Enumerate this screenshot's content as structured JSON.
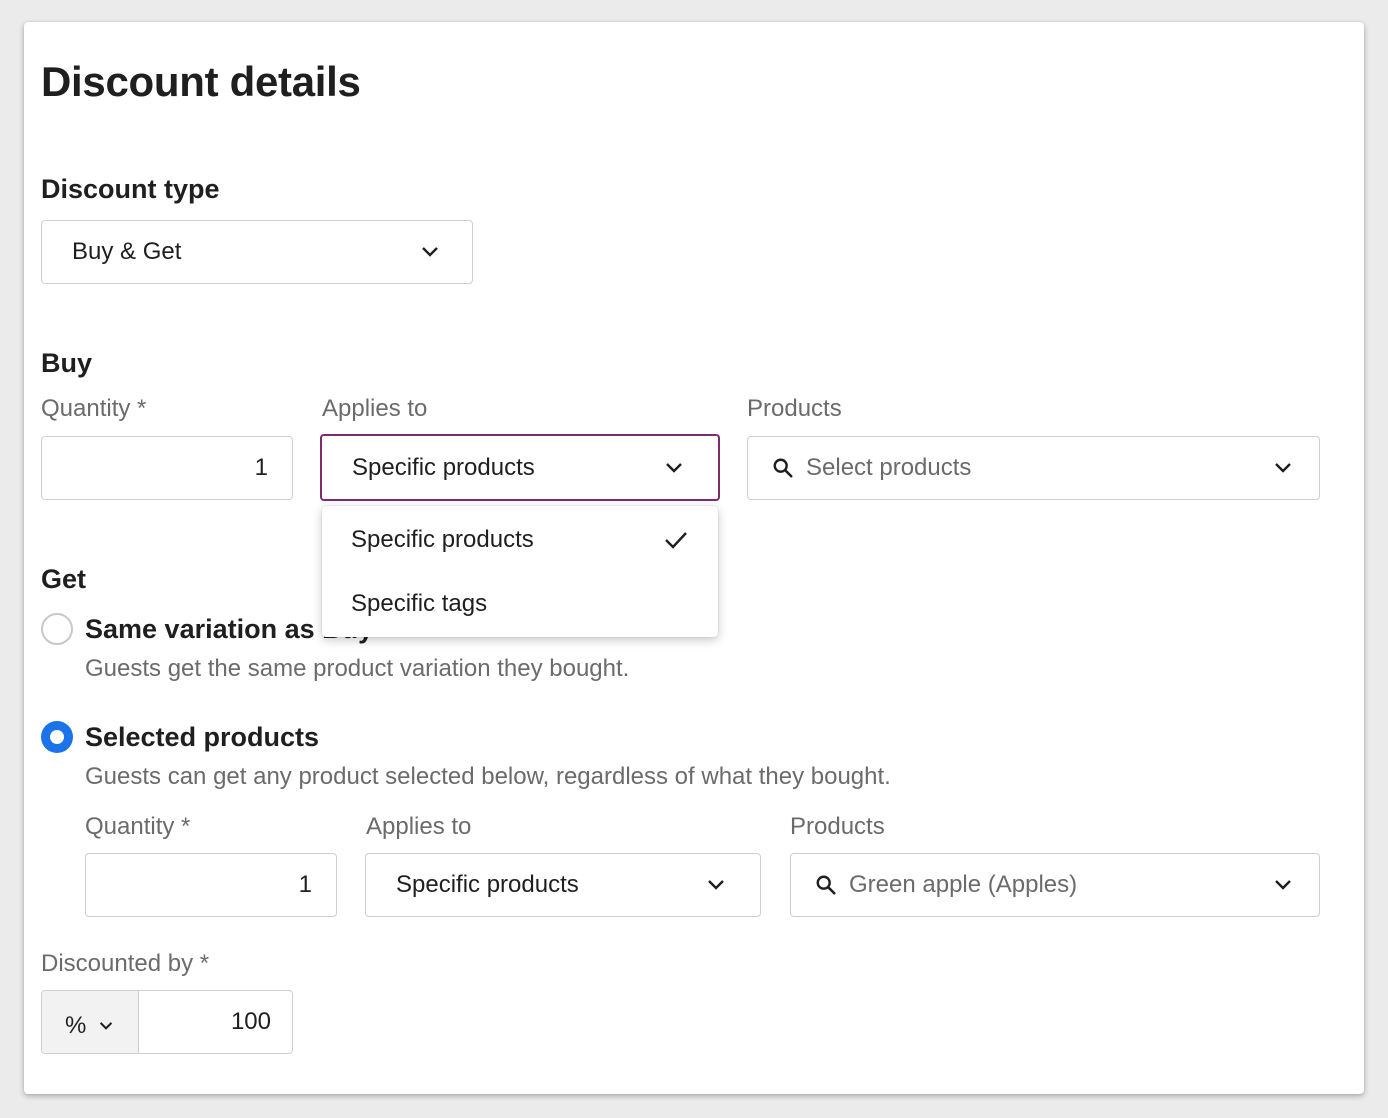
{
  "title": "Discount details",
  "discount_type": {
    "label": "Discount type",
    "value": "Buy & Get"
  },
  "buy": {
    "heading": "Buy",
    "quantity_label": "Quantity *",
    "quantity_value": "1",
    "applies_to_label": "Applies to",
    "applies_to_value": "Specific products",
    "products_label": "Products",
    "products_placeholder": "Select products",
    "applies_to_menu": [
      {
        "label": "Specific products",
        "selected": true
      },
      {
        "label": "Specific tags",
        "selected": false
      }
    ]
  },
  "get": {
    "heading": "Get",
    "options": [
      {
        "title": "Same variation as Buy",
        "description": "Guests get the same product variation they bought.",
        "selected": false
      },
      {
        "title": "Selected products",
        "description": "Guests can get any product selected below, regardless of what they bought.",
        "selected": true
      }
    ],
    "quantity_label": "Quantity *",
    "quantity_value": "1",
    "applies_to_label": "Applies to",
    "applies_to_value": "Specific products",
    "products_label": "Products",
    "products_value": "Green apple (Apples)"
  },
  "discounted_by": {
    "label": "Discounted by *",
    "unit": "%",
    "value": "100"
  },
  "colors": {
    "focus_border": "#7e2a72",
    "radio_selected": "#1a73e8"
  },
  "icons": {
    "dropdown": "chevron-down-icon",
    "search": "search-icon",
    "selected": "checkmark-icon"
  }
}
